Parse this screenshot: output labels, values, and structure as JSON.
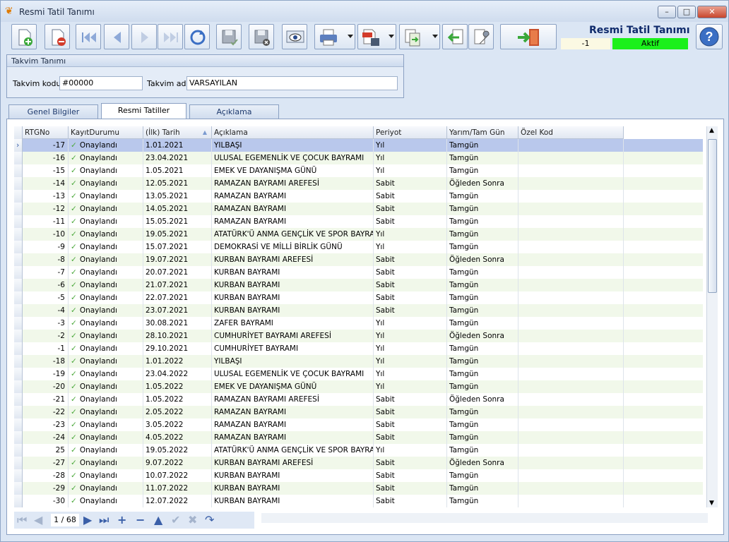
{
  "window": {
    "title": "Resmi Tatil Tanımı"
  },
  "header": {
    "form_title": "Resmi Tatil Tanımı",
    "record_number": "-1",
    "status": "Aktif"
  },
  "group": {
    "title": "Takvim Tanımı",
    "code_label": "Takvim kodu",
    "code_value": "#00000",
    "name_label": "Takvim adı",
    "name_value": "VARSAYILAN"
  },
  "tabs": [
    {
      "label": "Genel Bilgiler"
    },
    {
      "label": "Resmi Tatiller"
    },
    {
      "label": "Açıklama"
    }
  ],
  "grid": {
    "columns": [
      "RTGNo",
      "KayıtDurumu",
      "(İlk) Tarih",
      "Açıklama",
      "Periyot",
      "Yarım/Tam Gün",
      "Özel Kod"
    ],
    "rows": [
      [
        "-17",
        "Onaylandı",
        "1.01.2021",
        "YILBAŞI",
        "Yıl",
        "Tamgün",
        ""
      ],
      [
        "-16",
        "Onaylandı",
        "23.04.2021",
        "ULUSAL EGEMENLİK VE ÇOCUK BAYRAMI",
        "Yıl",
        "Tamgün",
        ""
      ],
      [
        "-15",
        "Onaylandı",
        "1.05.2021",
        "EMEK VE DAYANIŞMA GÜNÜ",
        "Yıl",
        "Tamgün",
        ""
      ],
      [
        "-14",
        "Onaylandı",
        "12.05.2021",
        "RAMAZAN BAYRAMI AREFESİ",
        "Sabit",
        "Öğleden Sonra",
        ""
      ],
      [
        "-13",
        "Onaylandı",
        "13.05.2021",
        "RAMAZAN BAYRAMI",
        "Sabit",
        "Tamgün",
        ""
      ],
      [
        "-12",
        "Onaylandı",
        "14.05.2021",
        "RAMAZAN BAYRAMI",
        "Sabit",
        "Tamgün",
        ""
      ],
      [
        "-11",
        "Onaylandı",
        "15.05.2021",
        "RAMAZAN BAYRAMI",
        "Sabit",
        "Tamgün",
        ""
      ],
      [
        "-10",
        "Onaylandı",
        "19.05.2021",
        "ATATÜRK'Ü ANMA GENÇLİK VE SPOR BAYRAMI",
        "Yıl",
        "Tamgün",
        ""
      ],
      [
        "-9",
        "Onaylandı",
        "15.07.2021",
        "DEMOKRASİ VE MİLLİ BİRLİK GÜNÜ",
        "Yıl",
        "Tamgün",
        ""
      ],
      [
        "-8",
        "Onaylandı",
        "19.07.2021",
        "KURBAN BAYRAMI AREFESİ",
        "Sabit",
        "Öğleden Sonra",
        ""
      ],
      [
        "-7",
        "Onaylandı",
        "20.07.2021",
        "KURBAN BAYRAMI",
        "Sabit",
        "Tamgün",
        ""
      ],
      [
        "-6",
        "Onaylandı",
        "21.07.2021",
        "KURBAN BAYRAMI",
        "Sabit",
        "Tamgün",
        ""
      ],
      [
        "-5",
        "Onaylandı",
        "22.07.2021",
        "KURBAN BAYRAMI",
        "Sabit",
        "Tamgün",
        ""
      ],
      [
        "-4",
        "Onaylandı",
        "23.07.2021",
        "KURBAN BAYRAMI",
        "Sabit",
        "Tamgün",
        ""
      ],
      [
        "-3",
        "Onaylandı",
        "30.08.2021",
        "ZAFER BAYRAMI",
        "Yıl",
        "Tamgün",
        ""
      ],
      [
        "-2",
        "Onaylandı",
        "28.10.2021",
        "CUMHURİYET BAYRAMI AREFESİ",
        "Yıl",
        "Öğleden Sonra",
        ""
      ],
      [
        "-1",
        "Onaylandı",
        "29.10.2021",
        "CUMHURİYET BAYRAMI",
        "Yıl",
        "Tamgün",
        ""
      ],
      [
        "-18",
        "Onaylandı",
        "1.01.2022",
        "YILBAŞI",
        "Yıl",
        "Tamgün",
        ""
      ],
      [
        "-19",
        "Onaylandı",
        "23.04.2022",
        "ULUSAL EGEMENLİK VE ÇOCUK BAYRAMI",
        "Yıl",
        "Tamgün",
        ""
      ],
      [
        "-20",
        "Onaylandı",
        "1.05.2022",
        "EMEK VE DAYANIŞMA GÜNÜ",
        "Yıl",
        "Tamgün",
        ""
      ],
      [
        "-21",
        "Onaylandı",
        "1.05.2022",
        "RAMAZAN BAYRAMI AREFESİ",
        "Sabit",
        "Öğleden Sonra",
        ""
      ],
      [
        "-22",
        "Onaylandı",
        "2.05.2022",
        "RAMAZAN BAYRAMI",
        "Sabit",
        "Tamgün",
        ""
      ],
      [
        "-23",
        "Onaylandı",
        "3.05.2022",
        "RAMAZAN BAYRAMI",
        "Sabit",
        "Tamgün",
        ""
      ],
      [
        "-24",
        "Onaylandı",
        "4.05.2022",
        "RAMAZAN BAYRAMI",
        "Sabit",
        "Tamgün",
        ""
      ],
      [
        "25",
        "Onaylandı",
        "19.05.2022",
        "ATATÜRK'Ü ANMA GENÇLİK VE SPOR BAYRAMI",
        "Yıl",
        "Tamgün",
        ""
      ],
      [
        "-27",
        "Onaylandı",
        "9.07.2022",
        "KURBAN BAYRAMI AREFESİ",
        "Sabit",
        "Öğleden Sonra",
        ""
      ],
      [
        "-28",
        "Onaylandı",
        "10.07.2022",
        "KURBAN BAYRAMI",
        "Sabit",
        "Tamgün",
        ""
      ],
      [
        "-29",
        "Onaylandı",
        "11.07.2022",
        "KURBAN BAYRAMI",
        "Sabit",
        "Tamgün",
        ""
      ],
      [
        "-30",
        "Onaylandı",
        "12.07.2022",
        "KURBAN BAYRAMI",
        "Sabit",
        "Tamgün",
        ""
      ]
    ]
  },
  "navigator": {
    "pager": "1 / 68"
  },
  "colors": {
    "active_status": "#1bf01b",
    "selected_row": "#b9c8ec",
    "alt_row": "#f1f8ea",
    "check": "#4aa83a"
  }
}
